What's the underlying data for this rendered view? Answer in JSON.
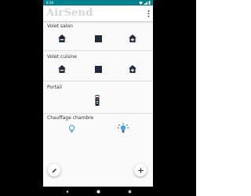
{
  "status_bar": {
    "time": "8:38",
    "icons": [
      "wifi-icon",
      "signal-icon",
      "battery-icon"
    ]
  },
  "app": {
    "title": "AirSend",
    "menu_icon": "more-vert-icon"
  },
  "sections": [
    {
      "title": "Volet salon",
      "buttons": [
        "shutter-down-icon",
        "stop-icon",
        "shutter-up-icon"
      ]
    },
    {
      "title": "Volet cuisine",
      "buttons": [
        "shutter-down-icon",
        "stop-icon",
        "shutter-up-icon"
      ]
    },
    {
      "title": "Portail",
      "buttons": [
        "remote-control-icon"
      ]
    },
    {
      "title": "Chauffage chambre",
      "buttons": [
        "light-off-icon",
        "light-on-icon"
      ]
    }
  ],
  "fabs": {
    "left_icon": "pencil-icon",
    "right_icon": "plus-icon"
  },
  "nav": {
    "icons": [
      "back-icon",
      "home-icon",
      "recents-icon"
    ]
  },
  "colors": {
    "status_bar": "#00838f",
    "icon_dark": "#1e2b3d",
    "bulb_outline": "#3ba6f0",
    "title_gray": "#d6d6d6"
  }
}
